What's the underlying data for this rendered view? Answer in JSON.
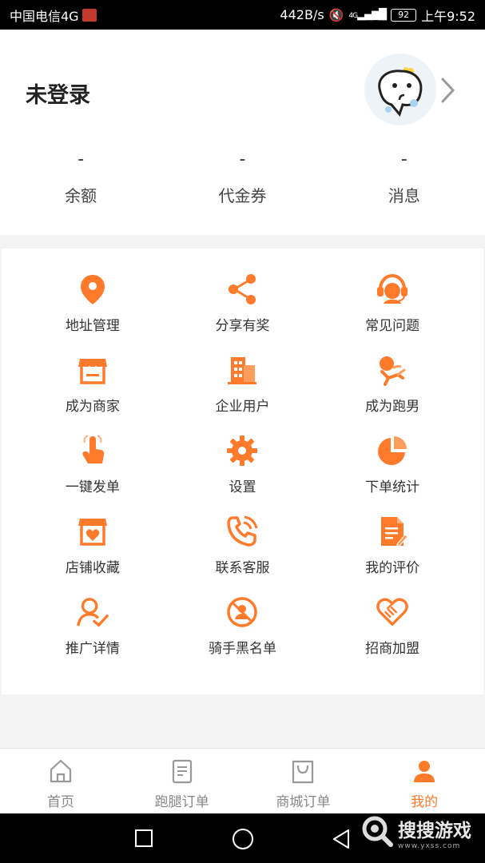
{
  "status_bar": {
    "carrier": "中国电信4G",
    "speed": "442B/s",
    "network": "4G",
    "battery": "92",
    "time": "上午9:52"
  },
  "profile": {
    "name": "未登录",
    "stats": [
      {
        "value": "-",
        "label": "余额"
      },
      {
        "value": "-",
        "label": "代金券"
      },
      {
        "value": "-",
        "label": "消息"
      }
    ]
  },
  "menu": [
    {
      "label": "地址管理",
      "icon": "location-pin-icon"
    },
    {
      "label": "分享有奖",
      "icon": "share-icon"
    },
    {
      "label": "常见问题",
      "icon": "customer-service-icon"
    },
    {
      "label": "成为商家",
      "icon": "storefront-icon"
    },
    {
      "label": "企业用户",
      "icon": "building-icon"
    },
    {
      "label": "成为跑男",
      "icon": "runner-icon"
    },
    {
      "label": "一键发单",
      "icon": "tap-hand-icon"
    },
    {
      "label": "设置",
      "icon": "gear-icon"
    },
    {
      "label": "下单统计",
      "icon": "pie-chart-icon"
    },
    {
      "label": "店铺收藏",
      "icon": "shop-heart-icon"
    },
    {
      "label": "联系客服",
      "icon": "phone-call-icon"
    },
    {
      "label": "我的评价",
      "icon": "document-edit-icon"
    },
    {
      "label": "推广详情",
      "icon": "user-check-icon"
    },
    {
      "label": "骑手黑名单",
      "icon": "blocked-user-icon"
    },
    {
      "label": "招商加盟",
      "icon": "handshake-icon"
    }
  ],
  "tabs": [
    {
      "label": "首页",
      "icon": "home-icon"
    },
    {
      "label": "跑腿订单",
      "icon": "order-list-icon"
    },
    {
      "label": "商城订单",
      "icon": "shopping-bag-icon"
    },
    {
      "label": "我的",
      "icon": "person-icon"
    }
  ],
  "watermark": {
    "text": "搜搜游戏",
    "url": "www.yxss.com"
  },
  "colors": {
    "accent": "#ff7a2a",
    "accent_light": "#ffb27a"
  }
}
